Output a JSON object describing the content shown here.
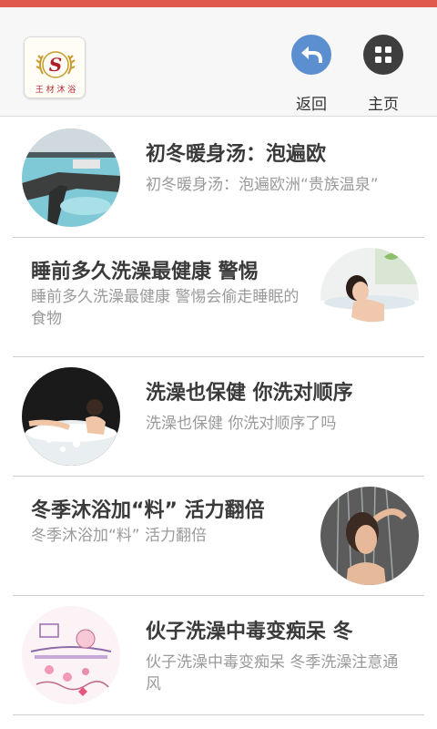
{
  "header": {
    "logo_text": "王 材 沐 浴",
    "back_label": "返回",
    "home_label": "主页"
  },
  "articles": [
    {
      "title": "初冬暖身汤：泡遍欧",
      "desc": "初冬暖身汤：泡遍欧洲“贵族温泉”",
      "image": "blue-lagoon-hot-spring"
    },
    {
      "title": "睡前多久洗澡最健康 警惕",
      "desc": "睡前多久洗澡最健康 警惕会偷走睡眠的食物",
      "image": "woman-in-bathtub"
    },
    {
      "title": "洗澡也保健 你洗对顺序",
      "desc": "洗澡也保健 你洗对顺序了吗",
      "image": "jacuzzi-bath"
    },
    {
      "title": "冬季沐浴加“料” 活力翻倍",
      "desc": "冬季沐浴加“料” 活力翻倍",
      "image": "woman-under-shower"
    },
    {
      "title": "伙子洗澡中毒变痴呆 冬",
      "desc": "伙子洗澡中毒变痴呆 冬季洗澡注意通风",
      "image": "cartoon-bathroom-illustration"
    }
  ],
  "colors": {
    "top_strip": "#e05a4e",
    "back_button": "#5b8fd0",
    "home_button": "#3e3e3e"
  }
}
